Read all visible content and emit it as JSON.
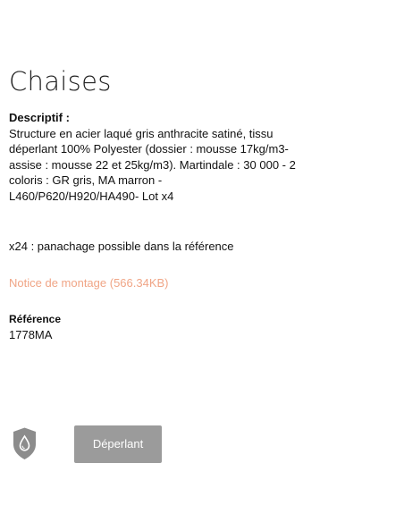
{
  "product": {
    "title": "Chaises",
    "description_label": "Descriptif :",
    "description": "Structure en acier laqué gris anthracite satiné, tissu\ndéperlant 100% Polyester (dossier : mousse 17kg/m3-\nassise : mousse 22 et 25kg/m3). Martindale : 30 000 - 2\ncoloris : GR gris, MA marron -\nL460/P620/H920/HA490- Lot x4",
    "note": "x24 : panachage possible dans la référence",
    "notice_link": "Notice de montage (566.34KB)",
    "reference_label": "Référence",
    "reference_value": "1778MA"
  },
  "features": {
    "icon": "water-drop-shield-icon",
    "button_label": "Déperlant"
  },
  "colors": {
    "link": "#f0a586",
    "button_bg": "#9b9b9b",
    "shield": "#8c8c8c"
  }
}
